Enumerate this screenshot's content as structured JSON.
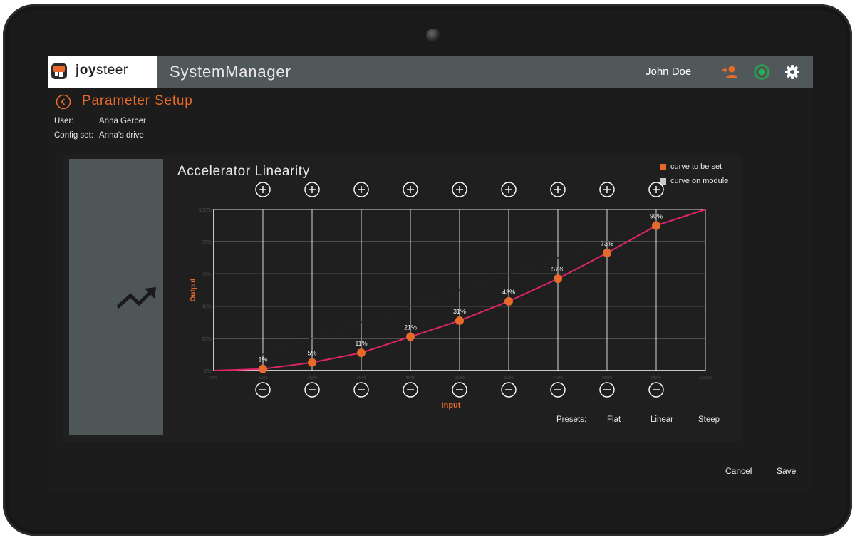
{
  "header": {
    "logo_text_bold": "joy",
    "logo_text_rest": "steer",
    "app_title": "SystemManager",
    "user_name": "John Doe",
    "icons": [
      "add-user-icon",
      "power-icon",
      "gear-icon"
    ],
    "colors": {
      "accent": "#e66a2a",
      "power": "#22b14c",
      "bar": "#515859"
    }
  },
  "page": {
    "title": "Parameter Setup",
    "user_label": "User:",
    "user_value": "Anna Gerber",
    "config_label": "Config set:",
    "config_value": "Anna's drive"
  },
  "legend": {
    "set_label": "curve to be set",
    "module_label": "curve on module",
    "set_color": "#e66a2a",
    "module_color": "#c8c8c8"
  },
  "presets": {
    "label": "Presets:",
    "options": [
      "Flat",
      "Linear",
      "Steep"
    ]
  },
  "footer": {
    "cancel": "Cancel",
    "save": "Save"
  },
  "chart_data": {
    "type": "line",
    "title": "Accelerator Linearity",
    "xlabel": "Input",
    "ylabel": "Output",
    "xlim": [
      0,
      100
    ],
    "ylim": [
      0,
      100
    ],
    "x_ticks": [
      "0%",
      "10%",
      "20%",
      "30%",
      "40%",
      "50%",
      "60%",
      "70%",
      "80%",
      "90%",
      "100%"
    ],
    "y_ticks": [
      "0%",
      "20%",
      "40%",
      "60%",
      "80%",
      "100%"
    ],
    "grid": true,
    "legend_position": "top-right",
    "series": [
      {
        "name": "curve on module",
        "x": [
          0,
          100
        ],
        "y": [
          0,
          100
        ],
        "color": "#222222"
      },
      {
        "name": "curve to be set",
        "x": [
          0,
          10,
          20,
          30,
          40,
          50,
          60,
          70,
          80,
          90,
          100
        ],
        "y": [
          0,
          1,
          5,
          11,
          21,
          31,
          43,
          57,
          73,
          90,
          100
        ],
        "color": "#e0246a",
        "point_color": "#e66a2a"
      }
    ],
    "point_labels": [
      "1%",
      "5%",
      "11%",
      "21%",
      "31%",
      "43%",
      "57%",
      "73%",
      "90%"
    ]
  }
}
